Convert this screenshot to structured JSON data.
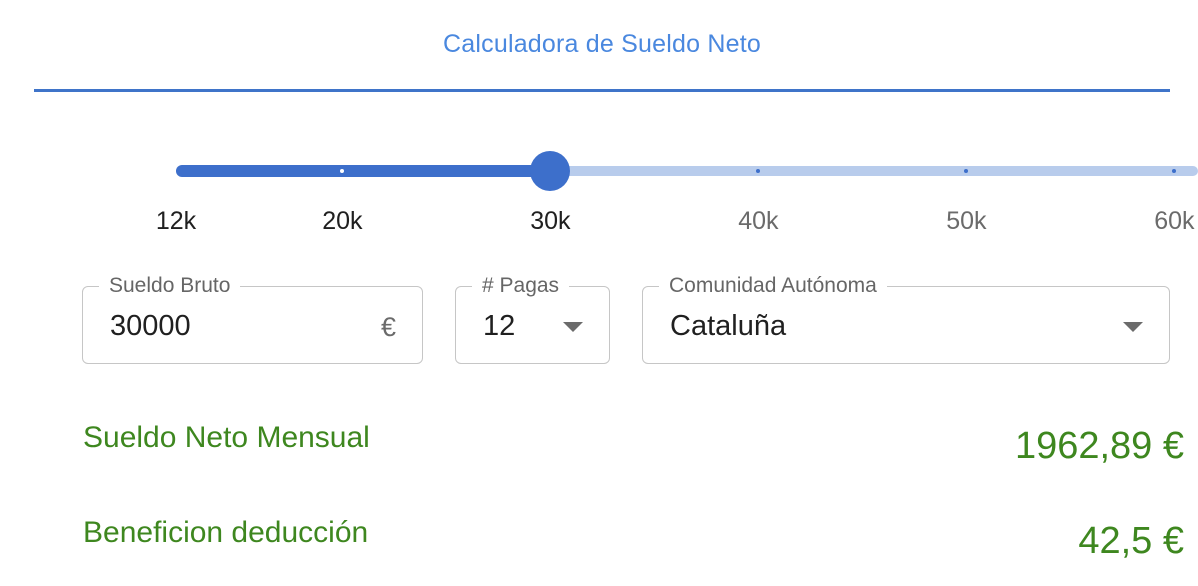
{
  "tabs": [
    {
      "label": "Calculadora de Sueldo Neto",
      "selected": true
    }
  ],
  "slider": {
    "min": 12,
    "max": 60,
    "value": 30,
    "marks": [
      {
        "value": 12,
        "label": "12k"
      },
      {
        "value": 20,
        "label": "20k"
      },
      {
        "value": 30,
        "label": "30k"
      },
      {
        "value": 40,
        "label": "40k"
      },
      {
        "value": 50,
        "label": "50k"
      },
      {
        "value": 60,
        "label": "60k"
      }
    ]
  },
  "form": {
    "sueldo_bruto": {
      "label": "Sueldo Bruto",
      "value": "30000",
      "unit": "€"
    },
    "pagas": {
      "label": "# Pagas",
      "value": "12"
    },
    "comunidad": {
      "label": "Comunidad Autónoma",
      "value": "Cataluña"
    }
  },
  "results": {
    "neto_mensual": {
      "label": "Sueldo Neto Mensual",
      "value": "1962,89 €"
    },
    "beneficio_deduccion": {
      "label": "Beneficion deducción",
      "value": "42,5 €"
    }
  },
  "colors": {
    "tab_text": "#4a88df",
    "slider_primary": "#3d6fcb",
    "slider_rail": "#b8ccec",
    "result_green": "#3e871f"
  }
}
